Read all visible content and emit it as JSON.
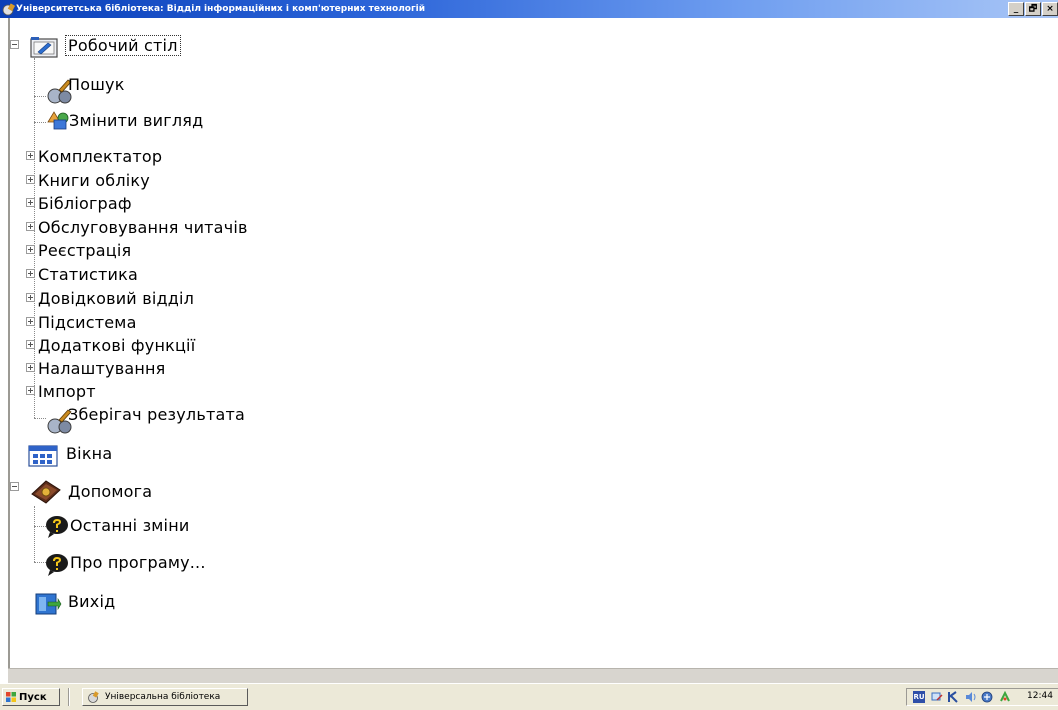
{
  "window": {
    "title": "Університетська бібліотека: Відділ інформаційних і комп'ютерних технологій",
    "buttons": [
      "_",
      "🗗",
      "×"
    ]
  },
  "tree": {
    "root": {
      "label": "Робочий стіл",
      "icon": "desktop-icon",
      "expanded": true
    },
    "items": {
      "search": {
        "label": "Пошук",
        "icon": "search-binoculars-icon"
      },
      "change_view": {
        "label": "Змінити вигляд",
        "icon": "shapes-icon"
      },
      "acquisitions": {
        "label": "Комплектатор"
      },
      "accounting_books": {
        "label": "Книги обліку"
      },
      "bibliographer": {
        "label": "Бібліограф"
      },
      "reader_service": {
        "label": "Обслуговування читачів"
      },
      "registration": {
        "label": "Реєстрація"
      },
      "statistics": {
        "label": "Статистика"
      },
      "reference_dept": {
        "label": "Довідковий відділ"
      },
      "subsystem": {
        "label": "Підсистема"
      },
      "extra_functions": {
        "label": "Додаткові функції"
      },
      "settings": {
        "label": "Налаштування"
      },
      "import": {
        "label": "Імпорт"
      },
      "result_saver": {
        "label": "Зберігач результата",
        "icon": "search-binoculars-icon"
      },
      "windows": {
        "label": "Вікна",
        "icon": "windows-grid-icon"
      },
      "help": {
        "label": "Допомога",
        "icon": "help-book-icon"
      },
      "recent_changes": {
        "label": "Останні зміни",
        "icon": "help-question-icon"
      },
      "about": {
        "label": "Про програму...",
        "icon": "help-question-icon"
      },
      "exit": {
        "label": "Вихід",
        "icon": "exit-door-icon"
      }
    }
  },
  "taskbar": {
    "start_label": "Пуск",
    "task_label": "Універсальна бібліотека",
    "clock": "12:44",
    "lang": "RU"
  },
  "colors": {
    "title_gradient_start": "#0a3fb8",
    "title_gradient_end": "#a9c6f6",
    "taskbar": "#ece9d8"
  }
}
